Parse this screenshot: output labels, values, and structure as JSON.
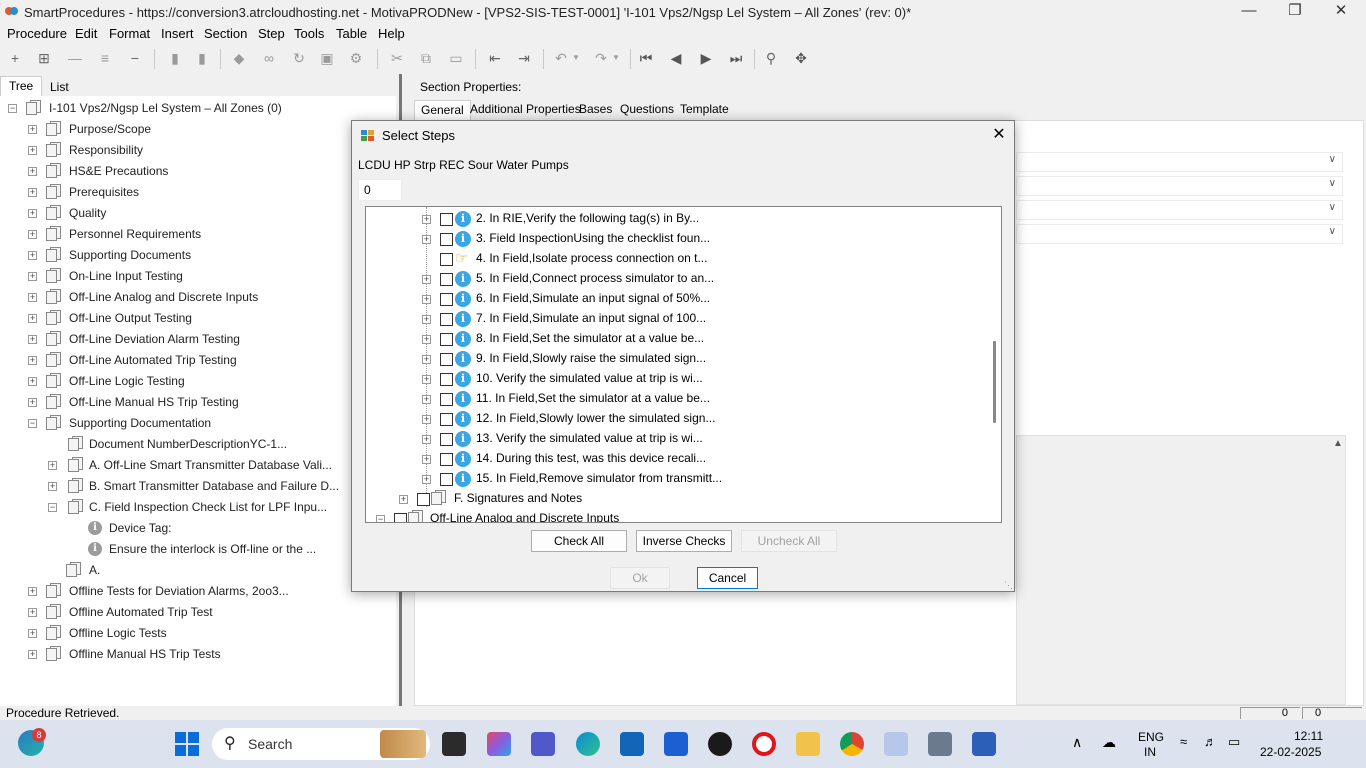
{
  "window": {
    "title": "SmartProcedures - https://conversion3.atrcloudhosting.net - MotivaPRODNew - [VPS2-SIS-TEST-0001] 'I-101 Vps2/Ngsp Lel System – All Zones' (rev: 0)*",
    "minimize_icon": "minimize-icon",
    "maximize_icon": "restore-icon",
    "close_icon": "close-icon"
  },
  "menu": [
    "Procedure",
    "Edit",
    "Format",
    "Insert",
    "Section",
    "Step",
    "Tools",
    "Table",
    "Help"
  ],
  "left_tabs": [
    "Tree",
    "List"
  ],
  "tree": {
    "root": "I-101 Vps2/Ngsp Lel System – All Zones (0)",
    "items": [
      "Purpose/Scope",
      "Responsibility",
      "HS&E Precautions",
      "Prerequisites",
      "Quality",
      "Personnel Requirements",
      "Supporting Documents",
      "On-Line Input Testing",
      "Off-Line Analog and Discrete Inputs",
      "Off-Line Output Testing",
      "Off-Line Deviation Alarm Testing",
      "Off-Line Automated Trip Testing",
      "Off-Line Logic Testing",
      "Off-Line Manual HS Trip Testing",
      "Supporting Documentation"
    ],
    "sub_items": [
      "Document NumberDescriptionYC-1...",
      "A. Off-Line Smart Transmitter Database Vali...",
      "B. Smart Transmitter Database and Failure D...",
      "C. Field Inspection Check List for LPF Inpu..."
    ],
    "sub_sub_items": [
      "Device Tag:",
      "Ensure the interlock is Off-line or the ..."
    ],
    "after_items": [
      "A.",
      "Offline Tests for Deviation Alarms, 2oo3...",
      "Offline Automated Trip Test",
      "Offline Logic Tests",
      "Offline Manual HS Trip Tests"
    ]
  },
  "right": {
    "section_properties": "Section Properties:",
    "tabs": [
      "General",
      "Additional Properties",
      "Bases",
      "Questions",
      "Template"
    ],
    "right_values": [
      "0",
      "0"
    ]
  },
  "status": "Procedure Retrieved.",
  "dialog": {
    "title": "Select Steps",
    "subtitle": "LCDU HP Strp REC Sour Water Pumps",
    "count": "0",
    "steps": [
      "2. In RIE,Verify the following tag(s) in By...",
      "3. Field InspectionUsing the checklist foun...",
      "4. In Field,Isolate process connection on t...",
      "5. In Field,Connect process simulator to an...",
      "6. In Field,Simulate an input signal of 50%...",
      "7. In Field,Simulate an input signal of 100...",
      "8. In Field,Set the simulator at a value be...",
      "9. In Field,Slowly raise the simulated sign...",
      "10. Verify the simulated value at trip is wi...",
      "11. In Field,Set the simulator at a value be...",
      "12. In Field,Slowly lower the simulated sign...",
      "13. Verify the simulated value at trip is wi...",
      "14. During this test, was this device recali...",
      "15. In Field,Remove simulator from transmitt..."
    ],
    "section_f": "F. Signatures and Notes",
    "next_section": "Off-Line Analog and Discrete Inputs",
    "buttons": {
      "check_all": "Check All",
      "inverse_checks": "Inverse Checks",
      "uncheck_all": "Uncheck All",
      "ok": "Ok",
      "cancel": "Cancel"
    }
  },
  "taskbar": {
    "search": "Search",
    "notification_count": "8",
    "lang_line1": "ENG",
    "lang_line2": "IN",
    "time": "12:11",
    "date": "22-02-2025"
  }
}
